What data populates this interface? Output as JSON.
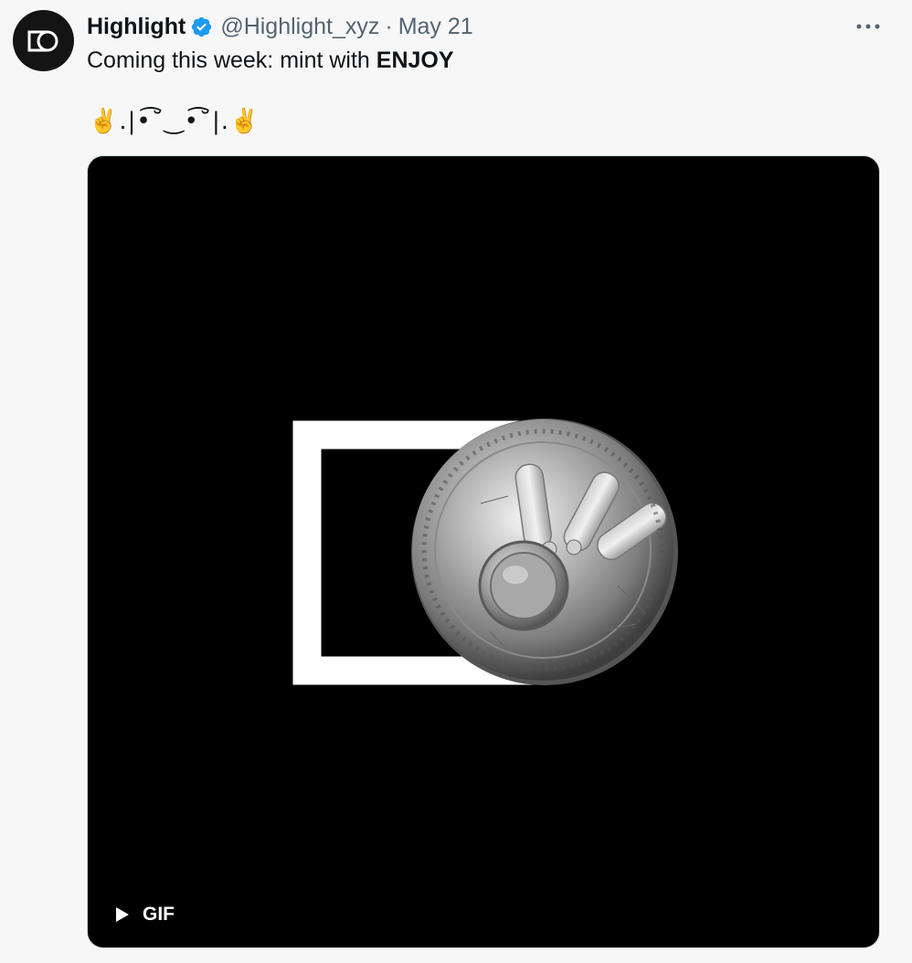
{
  "tweet": {
    "author_name": "Highlight",
    "handle": "@Highlight_xyz",
    "separator": "·",
    "date": "May 21",
    "text_plain": "Coming this week: mint with ",
    "text_bold": "ENJOY",
    "emoji_line": "✌️.|•͡˘‿•͡˘|.✌️",
    "media": {
      "badge_label": "GIF",
      "background": "#000000"
    }
  },
  "icons": {
    "avatar": "highlight-logo-icon",
    "verified": "verified-badge-icon",
    "more": "more-options-icon",
    "play": "play-icon"
  },
  "colors": {
    "verified_blue": "#1d9bf0",
    "secondary_text": "#536471",
    "primary_text": "#0f1419"
  }
}
